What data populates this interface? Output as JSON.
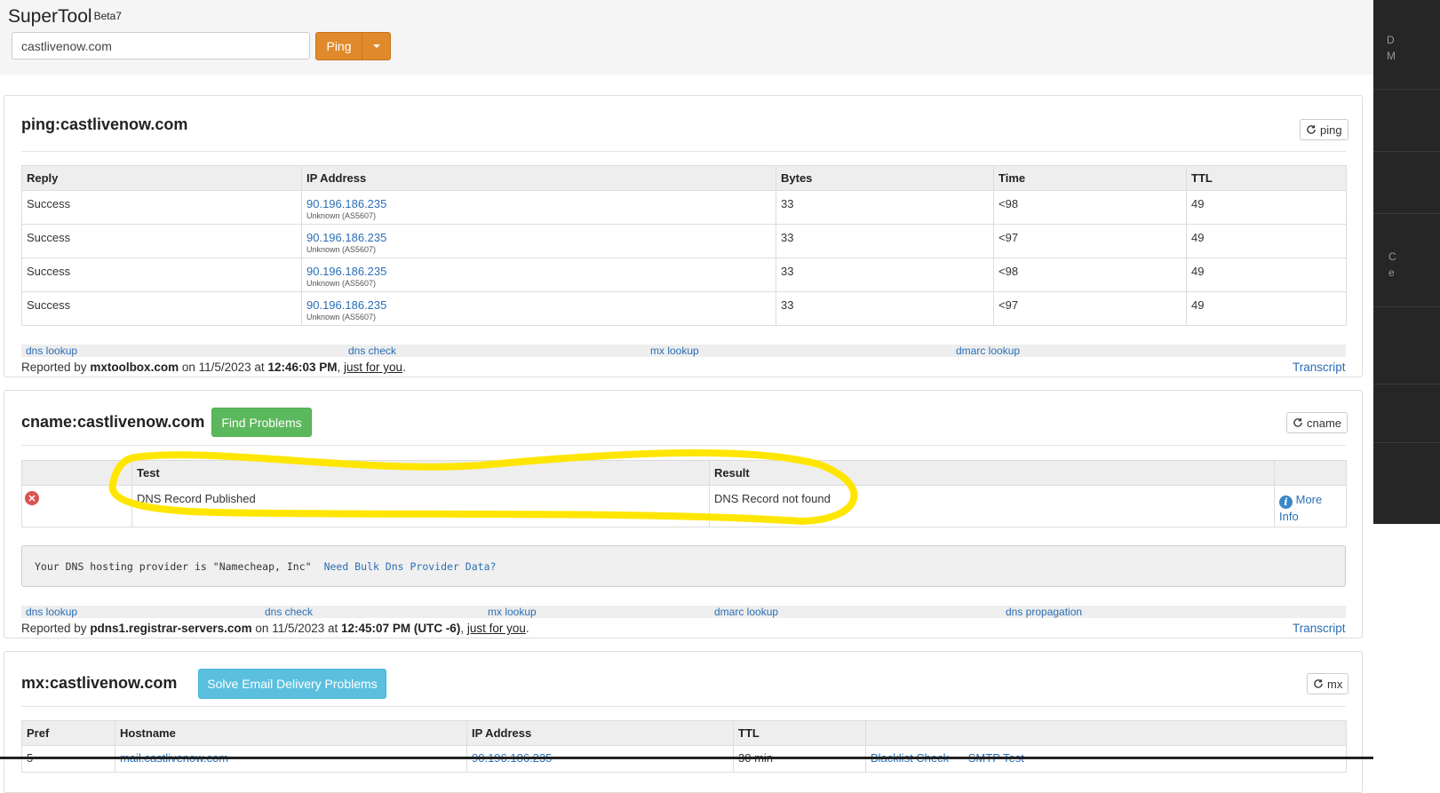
{
  "app": {
    "name": "SuperTool",
    "version": "Beta7"
  },
  "search": {
    "value": "castlivenow.com",
    "button": "Ping"
  },
  "sidebar_snippets": [
    "D",
    "M",
    "C",
    "e"
  ],
  "ping": {
    "title": "ping:castlivenow.com",
    "refresh_label": "ping",
    "columns": [
      "Reply",
      "IP Address",
      "Bytes",
      "Time",
      "TTL"
    ],
    "rows": [
      {
        "reply": "Success",
        "ip": "90.196.186.235",
        "asn": "Unknown (AS5607)",
        "bytes": "33",
        "time": "<98",
        "ttl": "49"
      },
      {
        "reply": "Success",
        "ip": "90.196.186.235",
        "asn": "Unknown (AS5607)",
        "bytes": "33",
        "time": "<97",
        "ttl": "49"
      },
      {
        "reply": "Success",
        "ip": "90.196.186.235",
        "asn": "Unknown (AS5607)",
        "bytes": "33",
        "time": "<98",
        "ttl": "49"
      },
      {
        "reply": "Success",
        "ip": "90.196.186.235",
        "asn": "Unknown (AS5607)",
        "bytes": "33",
        "time": "<97",
        "ttl": "49"
      }
    ],
    "links": [
      "dns lookup",
      "dns check",
      "mx lookup",
      "dmarc lookup"
    ],
    "report": {
      "prefix": "Reported by",
      "server": "mxtoolbox.com",
      "on": "on 11/5/2023 at",
      "time": "12:46:03 PM",
      "sep": ",",
      "just": "just for you",
      "end": "."
    },
    "transcript": "Transcript"
  },
  "cname": {
    "title": "cname:castlivenow.com",
    "action_button": "Find Problems",
    "refresh_label": "cname",
    "columns": [
      "Test",
      "Result"
    ],
    "row": {
      "test": "DNS Record Published",
      "result": "DNS Record not found",
      "more": "More",
      "info": "Info"
    },
    "provider_text": "Your DNS hosting provider is \"Namecheap, Inc\"",
    "provider_link": "Need Bulk Dns Provider Data?",
    "links": [
      "dns lookup",
      "dns check",
      "mx lookup",
      "dmarc lookup",
      "dns propagation"
    ],
    "report": {
      "prefix": "Reported by",
      "server": "pdns1.registrar-servers.com",
      "on": "on 11/5/2023 at",
      "time": "12:45:07 PM (UTC -6)",
      "sep": ",",
      "just": "just for you",
      "end": "."
    },
    "transcript": "Transcript"
  },
  "mx": {
    "title": "mx:castlivenow.com",
    "action_button": "Solve Email Delivery Problems",
    "refresh_label": "mx",
    "columns": [
      "Pref",
      "Hostname",
      "IP Address",
      "TTL",
      ""
    ],
    "partial_row": {
      "pref": "5",
      "hostname": "mail.castlivenow.com",
      "ip": "90.196.186.235",
      "ttl": "30 min",
      "blacklist": "Blacklist Check",
      "smtp": "SMTP Test"
    }
  },
  "colors": {
    "accent_orange": "#e08a2c",
    "success_green": "#5cb85c",
    "info_blue": "#5bc0de",
    "highlight": "#ffe600",
    "link": "#2a6fb5"
  }
}
